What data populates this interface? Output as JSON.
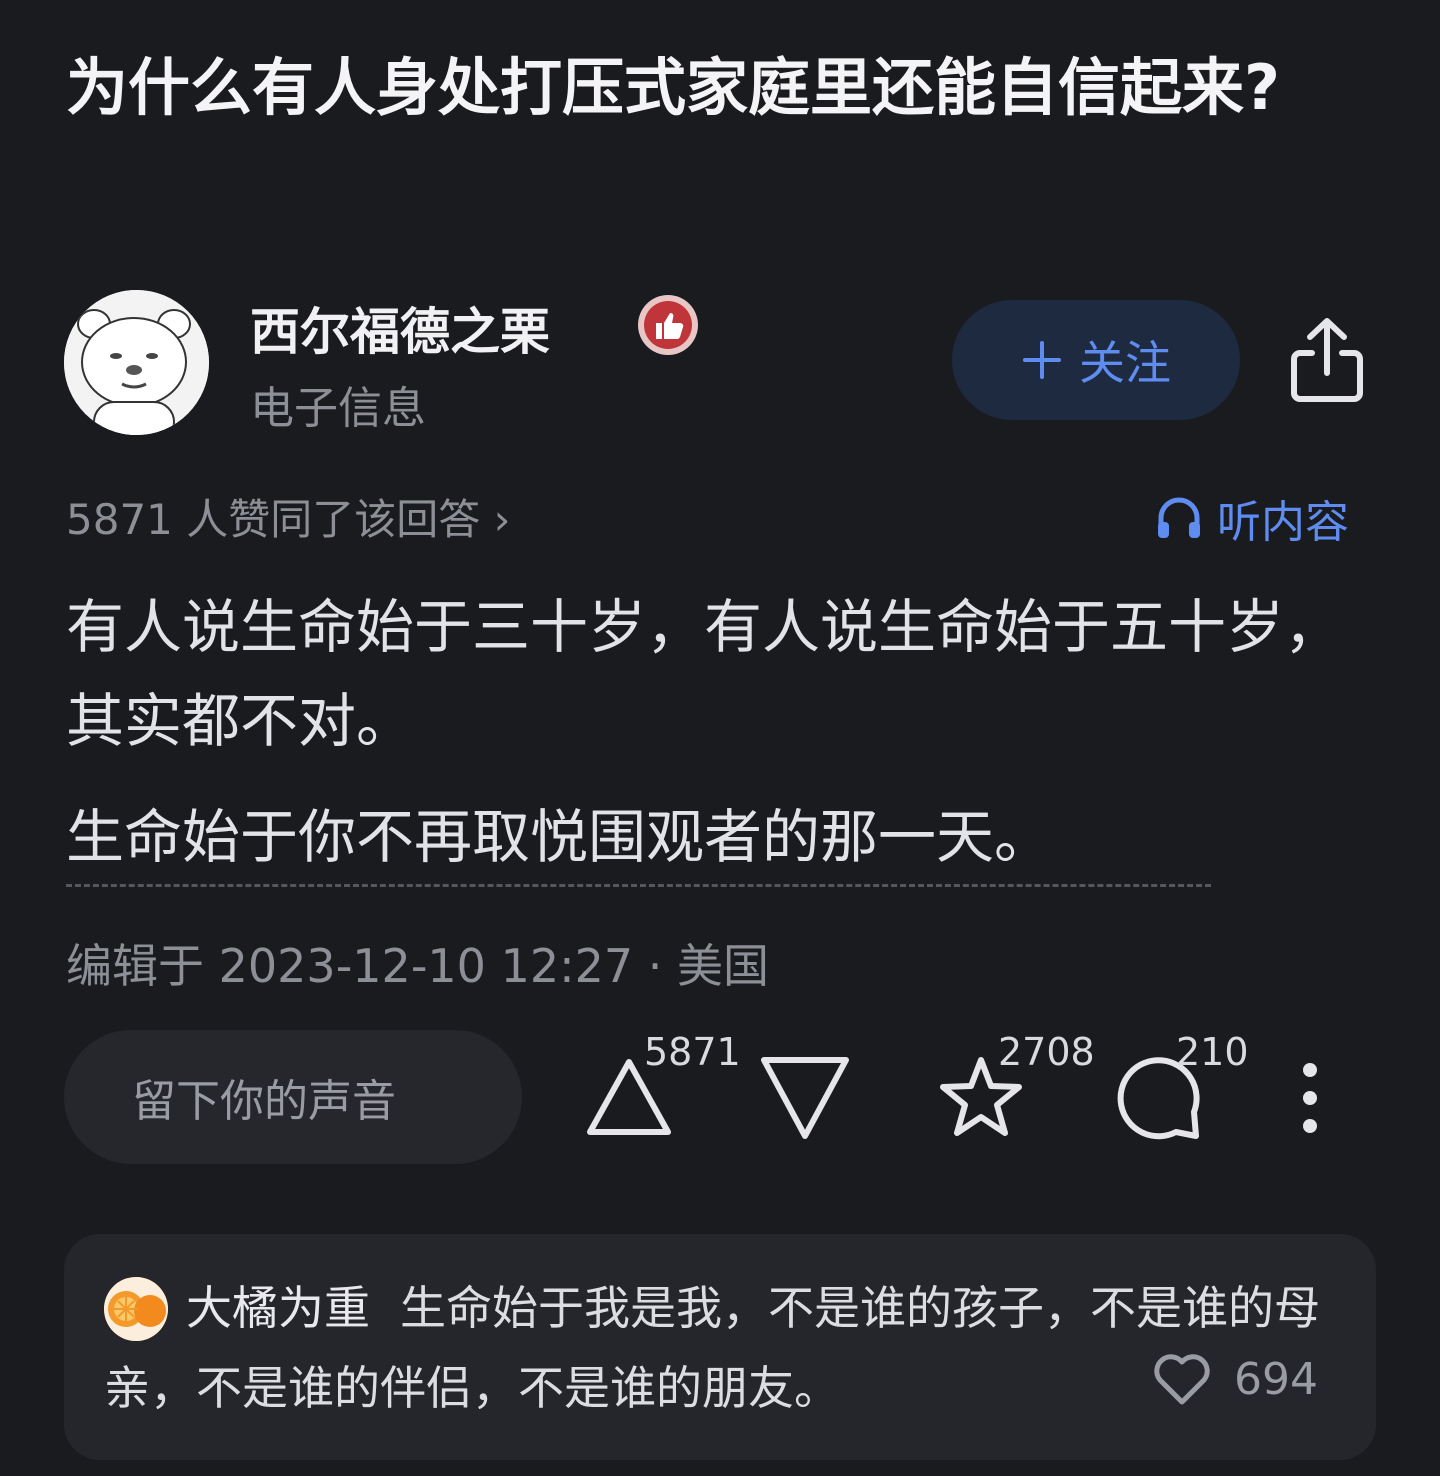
{
  "question": {
    "title": "为什么有人身处打压式家庭里还能自信起来?"
  },
  "author": {
    "name": "西尔福德之栗",
    "tag": "电子信息",
    "badge_icon": "thumbs-up-badge-icon"
  },
  "follow": {
    "label": "关注",
    "icon": "plus-icon"
  },
  "share": {
    "icon": "share-icon"
  },
  "answer": {
    "likes_line": "5871 人赞同了该回答 ›",
    "listen_label": "听内容",
    "paragraphs": [
      "有人说生命始于三十岁，有人说生命始于五十岁，其实都不对。",
      "生命始于你不再取悦围观者的那一天。"
    ],
    "edited": "编辑于 2023-12-10 12:27 · 美国"
  },
  "actions": {
    "comment_placeholder": "留下你的声音",
    "upvote_count": "5871",
    "favorite_count": "2708",
    "comment_count": "210"
  },
  "top_comment": {
    "user": "大橘为重",
    "text": "生命始于我是我，不是谁的孩子，不是谁的母亲，不是谁的伴侣，不是谁的朋友。",
    "likes": "694"
  },
  "colors": {
    "background": "#1a1b1f",
    "accent": "#5f8cf0",
    "badge": "#c0353a"
  }
}
